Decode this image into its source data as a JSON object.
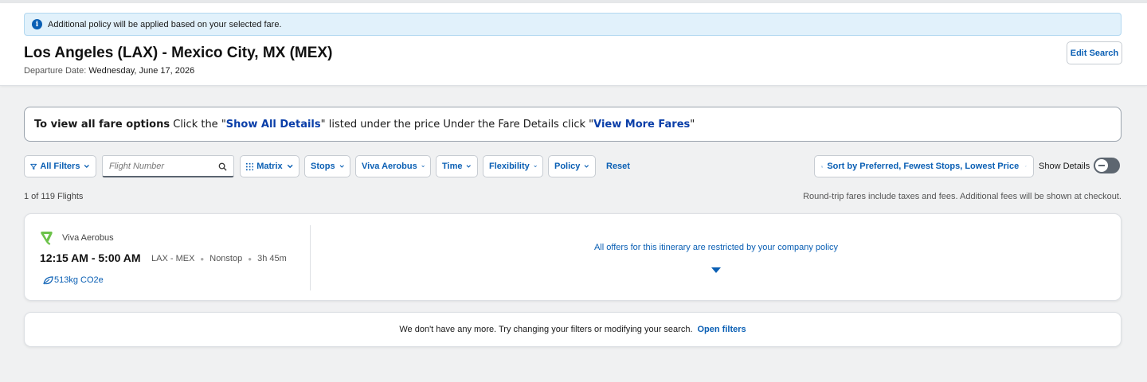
{
  "banner": {
    "text": "Additional policy will be applied based on your selected fare.",
    "icon": "info-icon"
  },
  "header": {
    "route_title": "Los Angeles (LAX) - Mexico City, MX (MEX)",
    "departure_label": "Departure Date:",
    "departure_value": "Wednesday, June 17, 2026",
    "edit_search_label": "Edit Search"
  },
  "fare_hint": {
    "part1_bold": "To view all fare options",
    "part2": " Click the \"",
    "link1": "Show All Details",
    "part3": "\" listed under the price Under the Fare Details click \"",
    "link2": "View More Fares",
    "part4": "\""
  },
  "filters": {
    "all_filters": "All Filters",
    "flight_number_placeholder": "Flight Number",
    "matrix": "Matrix",
    "stops": "Stops",
    "airline": "Viva Aerobus",
    "time": "Time",
    "flexibility": "Flexibility",
    "policy": "Policy",
    "reset": "Reset",
    "sort": "Sort by Preferred, Fewest Stops, Lowest Price",
    "show_details_label": "Show Details"
  },
  "results": {
    "count": "1 of 119 Flights",
    "fare_note": "Round-trip fares include taxes and fees. Additional fees will be shown at checkout."
  },
  "flight": {
    "airline": "Viva Aerobus",
    "times": "12:15 AM - 5:00 AM",
    "route": "LAX - MEX",
    "stops": "Nonstop",
    "duration": "3h 45m",
    "co2": "513kg CO2e",
    "restriction": "All offers for this itinerary are restricted by your company policy"
  },
  "end_message": {
    "text": "We don't have any more. Try changing your filters or modifying your search.",
    "link": "Open filters"
  },
  "colors": {
    "accent": "#0a5fb4",
    "banner_bg": "#e1f1fb",
    "airline_green": "#6cc24a"
  }
}
